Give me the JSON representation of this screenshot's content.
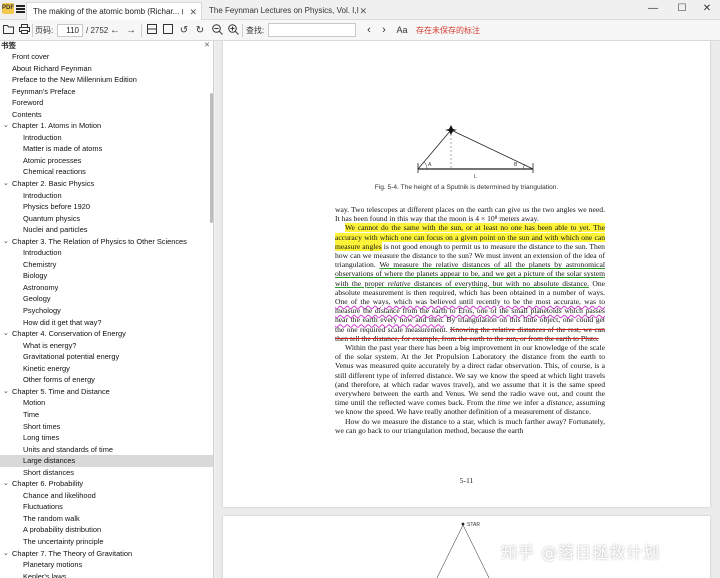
{
  "tabs": [
    {
      "title": "The making of the atomic bomb (Richar... (Z-...",
      "active": true
    },
    {
      "title": "The Feynman Lectures on Physics, Vol. I,II,III...",
      "active": false
    }
  ],
  "toolbar": {
    "page_label": "页码:",
    "page_value": "110",
    "page_total": "/ 2752",
    "search_label": "查找:",
    "search_value": "",
    "unsaved_notice": "存在未保存的标注",
    "case_icon_text": "Aa"
  },
  "sidebar": {
    "header": "书签",
    "items": [
      {
        "label": "Front cover",
        "level": 0
      },
      {
        "label": "About Richard Feynman",
        "level": 0
      },
      {
        "label": "Preface to the New Millennium Edition",
        "level": 0
      },
      {
        "label": "Feynman's Preface",
        "level": 0
      },
      {
        "label": "Foreword",
        "level": 0
      },
      {
        "label": "Contents",
        "level": 0
      },
      {
        "label": "Chapter 1. Atoms in Motion",
        "level": 0,
        "expanded": true
      },
      {
        "label": "Introduction",
        "level": 1
      },
      {
        "label": "Matter is made of atoms",
        "level": 1
      },
      {
        "label": "Atomic processes",
        "level": 1
      },
      {
        "label": "Chemical reactions",
        "level": 1
      },
      {
        "label": "Chapter 2. Basic Physics",
        "level": 0,
        "expanded": true
      },
      {
        "label": "Introduction",
        "level": 1
      },
      {
        "label": "Physics before 1920",
        "level": 1
      },
      {
        "label": "Quantum physics",
        "level": 1
      },
      {
        "label": "Nuclei and particles",
        "level": 1
      },
      {
        "label": "Chapter 3. The Relation of Physics to Other Sciences",
        "level": 0,
        "expanded": true
      },
      {
        "label": "Introduction",
        "level": 1
      },
      {
        "label": "Chemistry",
        "level": 1
      },
      {
        "label": "Biology",
        "level": 1
      },
      {
        "label": "Astronomy",
        "level": 1
      },
      {
        "label": "Geology",
        "level": 1
      },
      {
        "label": "Psychology",
        "level": 1
      },
      {
        "label": "How did it get that way?",
        "level": 1
      },
      {
        "label": "Chapter 4. Conservation of Energy",
        "level": 0,
        "expanded": true
      },
      {
        "label": "What is energy?",
        "level": 1
      },
      {
        "label": "Gravitational potential energy",
        "level": 1
      },
      {
        "label": "Kinetic energy",
        "level": 1
      },
      {
        "label": "Other forms of energy",
        "level": 1
      },
      {
        "label": "Chapter 5. Time and Distance",
        "level": 0,
        "expanded": true
      },
      {
        "label": "Motion",
        "level": 1
      },
      {
        "label": "Time",
        "level": 1
      },
      {
        "label": "Short times",
        "level": 1
      },
      {
        "label": "Long times",
        "level": 1
      },
      {
        "label": "Units and standards of time",
        "level": 1
      },
      {
        "label": "Large distances",
        "level": 1,
        "selected": true
      },
      {
        "label": "Short distances",
        "level": 1
      },
      {
        "label": "Chapter 6. Probability",
        "level": 0,
        "expanded": true
      },
      {
        "label": "Chance and likelihood",
        "level": 1
      },
      {
        "label": "Fluctuations",
        "level": 1
      },
      {
        "label": "The random walk",
        "level": 1
      },
      {
        "label": "A probability distribution",
        "level": 1
      },
      {
        "label": "The uncertainty principle",
        "level": 1
      },
      {
        "label": "Chapter 7. The Theory of Gravitation",
        "level": 0,
        "expanded": true
      },
      {
        "label": "Planetary motions",
        "level": 1
      },
      {
        "label": "Kepler's laws",
        "level": 1
      }
    ]
  },
  "document": {
    "figure_caption": "Fig. 5-4.  The height of a Sputnik is determined by triangulation.",
    "figure_labels": {
      "a": "A",
      "b": "B",
      "L": "L"
    },
    "p1": "way.  Two telescopes at different places on the earth can give us the two angles we need.  It has been found in this way that the moon is 4 × 10⁸ meters away.",
    "p2_hl": "We cannot do the same with the sun, or at least no one has been able to yet. The accuracy with which one can focus on a given point on the sun and with which one can measure angles",
    "p2_rest": " is not good enough to permit us to measure the distance to the sun.  Then how can we measure the distance to the sun?  We must invent an extension of the idea of triangulation. ",
    "p2_green_a": "We measure the relative distances of all the planets by astronomical observations of where the planets appear to be, and we get a picture of the solar system with the proper ",
    "p2_green_it": "relative",
    "p2_green_b": " distances of everything, but with no absolute distance.",
    "p2_c": " One absolute measurement is then required, which has been obtained in a number of ways. ",
    "p2_wavy": "One of the ways, which was believed until recently to be the most accurate, was to measure the distance from the earth to Eros, one of the small planetoids which passes near the earth every now and then.",
    "p2_d": " By triangulation on this little object, one could get the one required scale measurement. ",
    "p2_strike": "Knowing the relative distances of the rest, we can then tell the distance, for example, from the earth to the sun, or from the earth to Pluto.",
    "p3_a": "Within the past year there has been a big improvement in our knowledge of the scale of the solar system.  At the Jet Propulsion Laboratory the distance from the earth to Venus was measured quite accurately by a direct radar observation. This, of course, is a still different type of inferred distance.  We say we know the speed at which light travels (and therefore, at which radar waves travel), and we assume that it is the same speed everywhere between the earth and Venus.  We send the radio wave out, and count the time until the reflected wave comes back. From the ",
    "p3_time": "time",
    "p3_b": " we infer a ",
    "p3_distance": "distance",
    "p3_c": ", assuming we know the speed.  We have really another definition of a measurement of distance.",
    "p4": "How do we measure the distance to a star, which is much farther away? Fortunately, we can go back to our triangulation method, because the earth",
    "page_number": "5-11",
    "page2_star_label": "STAR"
  },
  "watermark": "知乎 @落日拯救计划"
}
